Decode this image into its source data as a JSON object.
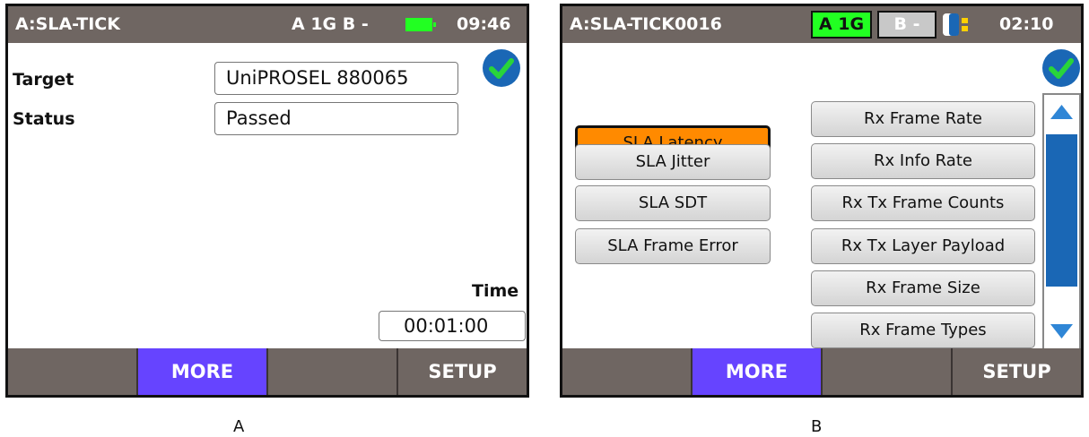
{
  "screen_a": {
    "title": "A:SLA-TICK",
    "ports": "A 1G B -",
    "clock": "09:46",
    "fields": {
      "target_label": "Target",
      "target_value": "UniPROSEL 880065",
      "status_label": "Status",
      "status_value": "Passed",
      "time_label": "Time",
      "time_value": "00:01:00"
    },
    "softkeys": [
      "",
      "MORE",
      "",
      "SETUP"
    ],
    "caption": "A"
  },
  "screen_b": {
    "title": "A:SLA-TICK0016",
    "port_a": "A 1G",
    "port_b": "B -",
    "clock": "02:10",
    "left_buttons": [
      "SLA Latency",
      "SLA Jitter",
      "SLA SDT",
      "SLA Frame Error"
    ],
    "right_buttons": [
      "Rx Frame Rate",
      "Rx Info Rate",
      "Rx Tx Frame Counts",
      "Rx Tx Layer Payload",
      "Rx Frame Size",
      "Rx Frame Types"
    ],
    "softkeys": [
      "",
      "MORE",
      "",
      "SETUP"
    ],
    "caption": "B"
  },
  "colors": {
    "titlebar": "#6f6662",
    "accent_blue": "#1a67b5",
    "selected_orange": "#ff8a00",
    "port_active_green": "#22ff22",
    "softkey_active": "#6644ff"
  }
}
